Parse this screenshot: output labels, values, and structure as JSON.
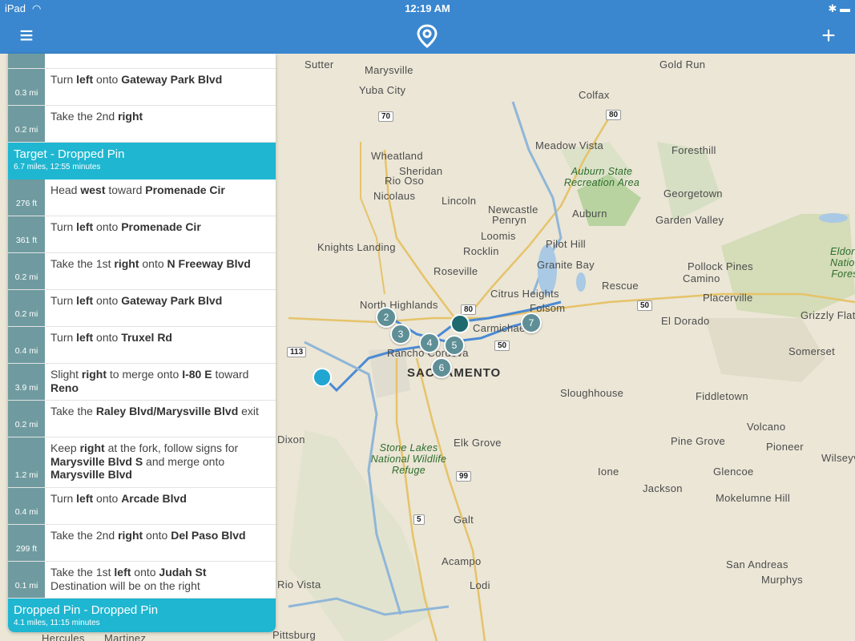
{
  "status": {
    "device": "iPad",
    "time": "12:19 AM"
  },
  "nav": {
    "menu_icon": "menu-icon",
    "logo_icon": "map-pin-logo-icon",
    "add_icon": "plus-icon"
  },
  "panel": {
    "top_steps": [
      {
        "dist": "0.3 mi",
        "parts": [
          "Turn ",
          "left",
          " onto ",
          "Gateway Park Blvd"
        ]
      },
      {
        "dist": "0.2 mi",
        "parts": [
          "Take the 2nd ",
          "right",
          "",
          ""
        ]
      }
    ],
    "section1": {
      "title": "Target - Dropped Pin",
      "sub": "6.7 miles, 12:55 minutes"
    },
    "steps": [
      {
        "dist": "276 ft",
        "parts": [
          "Head ",
          "west",
          " toward ",
          "Promenade Cir"
        ]
      },
      {
        "dist": "361 ft",
        "parts": [
          "Turn ",
          "left",
          " onto ",
          "Promenade Cir"
        ]
      },
      {
        "dist": "0.2 mi",
        "parts": [
          "Take the 1st ",
          "right",
          " onto ",
          "N Freeway Blvd"
        ]
      },
      {
        "dist": "0.2 mi",
        "parts": [
          "Turn ",
          "left",
          " onto ",
          "Gateway Park Blvd"
        ]
      },
      {
        "dist": "0.4 mi",
        "parts": [
          "Turn ",
          "left",
          " onto ",
          "Truxel Rd"
        ]
      },
      {
        "dist": "3.9 mi",
        "parts": [
          "Slight ",
          "right",
          " to merge onto ",
          "I-80 E",
          " toward ",
          "Reno"
        ]
      },
      {
        "dist": "0.2 mi",
        "parts": [
          "Take the ",
          "Raley Blvd/Marysville Blvd",
          " exit"
        ]
      },
      {
        "dist": "1.2 mi",
        "parts": [
          "Keep ",
          "right",
          " at the fork, follow signs for ",
          "Marysville Blvd S",
          " and merge onto ",
          "Marysville Blvd"
        ]
      },
      {
        "dist": "0.4 mi",
        "parts": [
          "Turn ",
          "left",
          " onto ",
          "Arcade Blvd"
        ]
      },
      {
        "dist": "299 ft",
        "parts": [
          "Take the 2nd ",
          "right",
          " onto ",
          "Del Paso Blvd"
        ]
      },
      {
        "dist": "0.1 mi",
        "parts": [
          "Take the 1st ",
          "left",
          " onto ",
          "Judah St",
          "Destination will be on the right"
        ]
      }
    ],
    "section2": {
      "title": "Dropped Pin - Dropped Pin",
      "sub": "4.1 miles, 11:15 minutes"
    }
  },
  "map": {
    "places": [
      "Sutter",
      "Marysville",
      "Yuba City",
      "Gold Run",
      "Colfax",
      "Meadow Vista",
      "Foresthill",
      "Wheatland",
      "Sheridan",
      "Rio Oso",
      "Nicolaus",
      "Auburn State Recreation Area",
      "Georgetown",
      "Lincoln",
      "Newcastle",
      "Penryn",
      "Auburn",
      "Garden Valley",
      "Loomis",
      "Pilot Hill",
      "Knights Landing",
      "Rocklin",
      "Granite Bay",
      "Roseville",
      "Pollock Pines",
      "Camino",
      "Placerville",
      "Citrus Heights",
      "Rescue",
      "North Highlands",
      "Folsom",
      "El Dorado",
      "Grizzly Flats",
      "Carmichael",
      "Rancho Cordova",
      "SACRAMENTO",
      "Somerset",
      "Sloughhouse",
      "Fiddletown",
      "Dixon",
      "Elk Grove",
      "Volcano",
      "Pine Grove",
      "Pioneer",
      "Stone Lakes National Wildlife Refuge",
      "Ione",
      "Glencoe",
      "Wilseyville",
      "Jackson",
      "Mokelumne Hill",
      "Galt",
      "San Andreas",
      "Acampo",
      "Murphys",
      "Lodi",
      "Rio Vista",
      "Hercules",
      "Martinez",
      "Pittsburg",
      "Eldorado National Forest"
    ],
    "shields": [
      "70",
      "80",
      "50",
      "113",
      "99",
      "5",
      "50",
      "80"
    ],
    "stops": [
      "2",
      "3",
      "4",
      "5",
      "6",
      "7"
    ]
  }
}
